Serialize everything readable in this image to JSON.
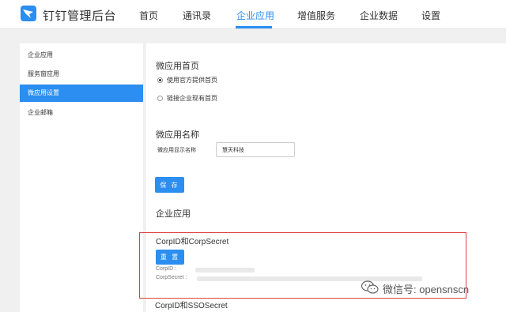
{
  "header": {
    "brand": "钉钉管理后台",
    "nav": [
      "首页",
      "通讯录",
      "企业应用",
      "增值服务",
      "企业数据",
      "设置"
    ],
    "active_nav": "企业应用"
  },
  "sidebar": {
    "items": [
      "企业应用",
      "服务窗应用",
      "微应用设置",
      "企业邮箱"
    ],
    "active": "微应用设置"
  },
  "homepage": {
    "title": "微应用首页",
    "options": [
      "使用官方提供首页",
      "链接企业现有首页"
    ],
    "selected": "使用官方提供首页"
  },
  "name_section": {
    "title": "微应用名称",
    "field_label": "微应用显示名称",
    "field_value": "慧天科技",
    "save_label": "保 存"
  },
  "enterprise_apps": {
    "title": "企业应用",
    "corp_secret_title": "CorpID和CorpSecret",
    "reset_label": "重 置",
    "corpid_label": "CorpID :",
    "corpsecret_label": "CorpSecret :",
    "sso_title": "CorpID和SSOSecret"
  },
  "watermark": {
    "text": "微信号: opensnscn"
  },
  "colors": {
    "accent": "#2b8ef0",
    "highlight_border": "#d9443c"
  }
}
